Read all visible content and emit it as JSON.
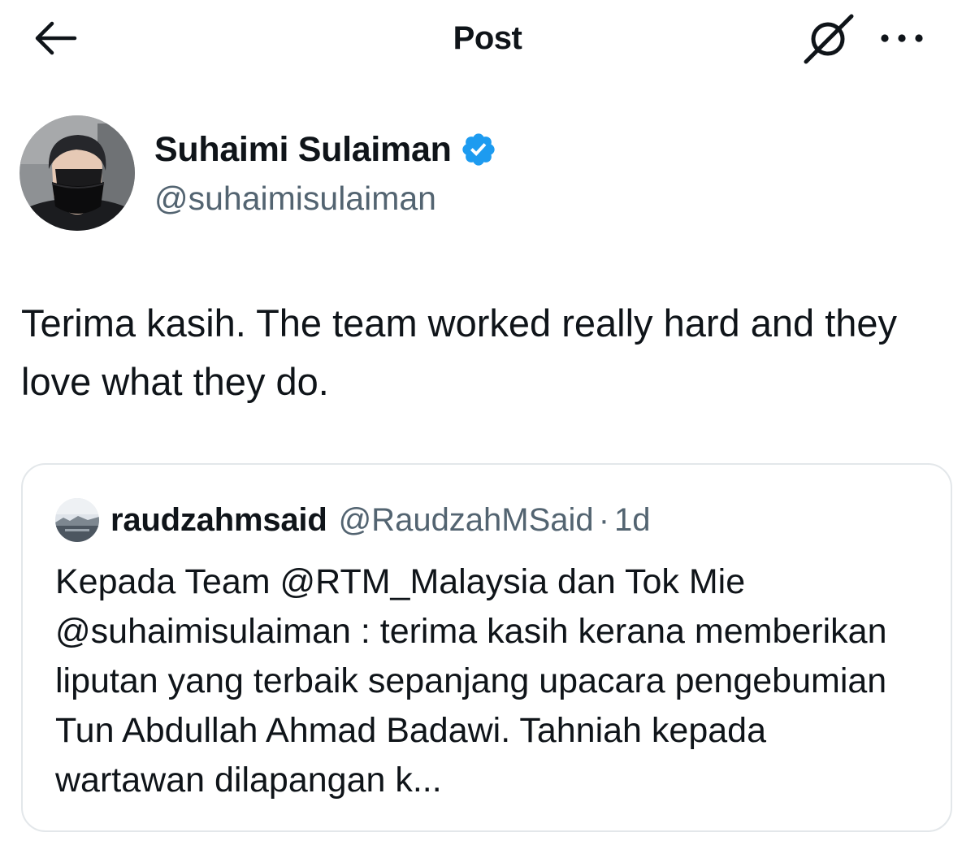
{
  "header": {
    "title": "Post",
    "back_icon": "arrow-left-icon",
    "grok_icon": "grok-icon",
    "more_icon": "more-horizontal-icon"
  },
  "author": {
    "display_name": "Suhaimi Sulaiman",
    "handle": "@suhaimisulaiman",
    "verified": true,
    "verified_color": "#1d9bf0"
  },
  "post": {
    "text": "Terima kasih.  The team worked really hard and they love what they do."
  },
  "quoted_post": {
    "display_name": "raudzahmsaid",
    "handle": "@RaudzahMSaid",
    "separator": "·",
    "time": "1d",
    "text": "Kepada Team @RTM_Malaysia dan Tok Mie @suhaimisulaiman : terima kasih kerana memberikan liputan yang terbaik sepanjang upacara pengebumian Tun Abdullah Ahmad Badawi. Tahniah kepada wartawan dilapangan k..."
  },
  "colors": {
    "text_primary": "#0f1419",
    "text_secondary": "#536471",
    "border": "#e3e7ea",
    "background": "#ffffff"
  }
}
